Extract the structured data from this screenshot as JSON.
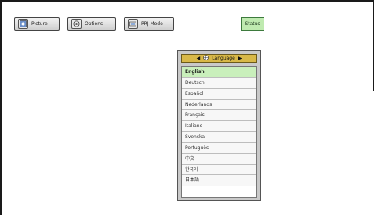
{
  "tabs": [
    {
      "label": "Picture",
      "icon": "picture-icon"
    },
    {
      "label": "Options",
      "icon": "options-icon"
    },
    {
      "label": "PRJ Mode",
      "icon": "prj-mode-icon"
    }
  ],
  "status_tab": {
    "label": "Status"
  },
  "menu": {
    "title": "Language",
    "selected_index": 0,
    "items": [
      "English",
      "Deutsch",
      "Español",
      "Nederlands",
      "Français",
      "Italiano",
      "Svenska",
      "Português",
      "中文",
      "한국어",
      "日本語"
    ]
  },
  "colors": {
    "status_bg": "#bfeab0",
    "header_bg": "#d8b848",
    "selected_bg": "#c9efbb"
  }
}
